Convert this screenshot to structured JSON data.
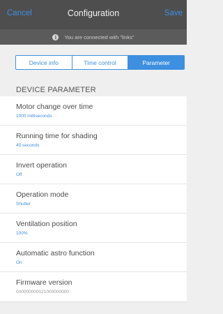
{
  "header": {
    "cancel_label": "Cancel",
    "title": "Configuration",
    "save_label": "Save"
  },
  "banner": {
    "icon": "info-icon",
    "text": "You are connected with \"links\""
  },
  "tabs": [
    {
      "label": "Device info",
      "active": false
    },
    {
      "label": "Time control",
      "active": false
    },
    {
      "label": "Parameter",
      "active": true
    }
  ],
  "section": {
    "title": "DEVICE PARAMETER"
  },
  "params": [
    {
      "label": "Motor change over time",
      "value": "1000 milliseconds"
    },
    {
      "label": "Running time for shading",
      "value": "45 seconds"
    },
    {
      "label": "Invert operation",
      "value": "Off"
    },
    {
      "label": "Operation mode",
      "value": "Shutter"
    },
    {
      "label": "Ventilation position",
      "value": "100%"
    },
    {
      "label": "Automatic astro function",
      "value": "On"
    },
    {
      "label": "Firmware version",
      "value": "000000000021000000000"
    }
  ],
  "colors": {
    "accent": "#3d8fe0",
    "header_bg": "#4e4e4e",
    "banner_bg": "#5b5b5b"
  }
}
